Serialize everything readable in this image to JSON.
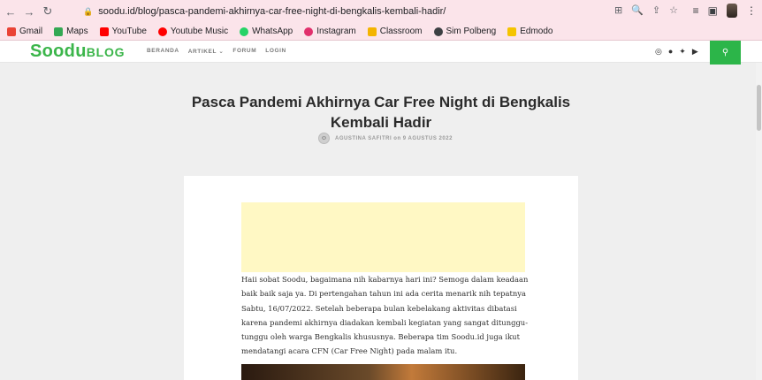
{
  "browser": {
    "url": "soodu.id/blog/pasca-pandemi-akhirnya-car-free-night-di-bengkalis-kembali-hadir/",
    "nav_icons": [
      "arrow-left-icon",
      "arrow-right-icon",
      "reload-icon"
    ],
    "bookmarks": [
      {
        "label": "Gmail",
        "icon": "gmail-icon",
        "color": "#ea4335"
      },
      {
        "label": "Maps",
        "icon": "maps-icon",
        "color": "#34a853"
      },
      {
        "label": "YouTube",
        "icon": "youtube-icon",
        "color": "#ff0000"
      },
      {
        "label": "Youtube Music",
        "icon": "youtube-music-icon",
        "color": "#ff0000"
      },
      {
        "label": "WhatsApp",
        "icon": "whatsapp-icon",
        "color": "#25d366"
      },
      {
        "label": "Instagram",
        "icon": "instagram-icon",
        "color": "#e1306c"
      },
      {
        "label": "Classroom",
        "icon": "classroom-icon",
        "color": "#f4b400"
      },
      {
        "label": "Sim Polbeng",
        "icon": "globe-icon",
        "color": "#3c4043"
      },
      {
        "label": "Edmodo",
        "icon": "edmodo-icon",
        "color": "#f5c400"
      }
    ]
  },
  "site": {
    "logo_main": "Soodu",
    "logo_sub": "BLOG",
    "menu": [
      "BERANDA",
      "ARTIKEL ⌄",
      "FORUM",
      "LOGIN"
    ],
    "social_icons": [
      "instagram-icon",
      "facebook-icon",
      "twitter-icon",
      "youtube-icon"
    ],
    "brand_color": "#2cb549"
  },
  "article": {
    "title": "Pasca Pandemi Akhirnya Car Free Night di Bengkalis Kembali Hadir",
    "byline": "AGUSTINA SAFITRI on 9 AGUSTUS 2022",
    "body": "Haii sobat Soodu, bagaimana nih kabarnya hari ini? Semoga dalam keadaan baik baik saja ya. Di pertengahan tahun ini ada cerita menarik nih tepatnya Sabtu, 16/07/2022. Setelah beberapa bulan kebelakang aktivitas dibatasi karena pandemi akhirnya diadakan kembali kegiatan yang sangat ditunggu-tunggu oleh warga Bengkalis khususnya. Beberapa tim Soodu.id juga ikut mendatangi acara CFN (Car Free Night) pada malam itu."
  }
}
